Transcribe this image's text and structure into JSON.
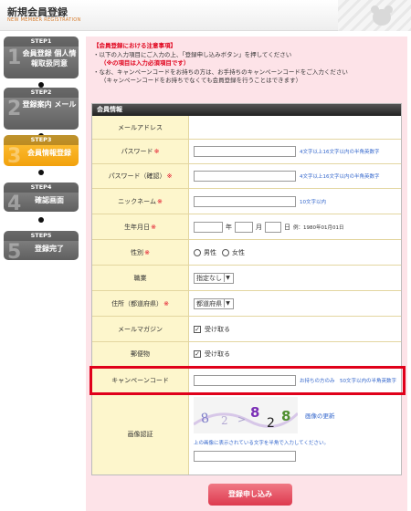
{
  "header": {
    "title": "新規会員登録",
    "subtitle": "NEW MEMBER REGISTRATION"
  },
  "steps": [
    {
      "label": "STEP1",
      "text": "会員登録 個人情報取扱同意",
      "num": "1",
      "active": false
    },
    {
      "label": "STEP2",
      "text": "登録案内 メール",
      "num": "2",
      "active": false
    },
    {
      "label": "STEP3",
      "text": "会員情報登録",
      "num": "3",
      "active": true
    },
    {
      "label": "STEP4",
      "text": "確認画面",
      "num": "4",
      "active": false
    },
    {
      "label": "STEP5",
      "text": "登録完了",
      "num": "5",
      "active": false
    }
  ],
  "notice": {
    "title": "【会員登録における注意事項】",
    "line1": "・以下の入力項目にご入力の上、「登録申し込みボタン」を押してください",
    "line2": "（※の項目は入力必須項目です）",
    "line3": "・なお、キャンペーンコードをお持ちの方は、お手持ちのキャンペーンコードをご入力ください",
    "line4": "（キャンペーンコードをお持ちでなくても会員登録を行うことはできます）"
  },
  "form": {
    "section_title": "会員情報",
    "email_label": "メールアドレス",
    "password_label": "パスワード",
    "password_hint": "4文字以上16文字以内の半角英数字",
    "password_confirm_label": "パスワード（確認）",
    "password_confirm_hint": "4文字以上16文字以内の半角英数字",
    "nickname_label": "ニックネーム",
    "nickname_hint": "10文字以内",
    "birth_label": "生年月日",
    "birth_year_unit": "年",
    "birth_month_unit": "月",
    "birth_day_unit": "日",
    "birth_example": "例：1980年01月01日",
    "gender_label": "性別",
    "gender_male": "男性",
    "gender_female": "女性",
    "job_label": "職業",
    "job_value": "指定なし",
    "address_label": "住所（都道府県）",
    "address_value": "都道府県",
    "magazine_label": "メールマガジン",
    "magazine_value": "受け取る",
    "mail_label": "郵便物",
    "mail_value": "受け取る",
    "campaign_label": "キャンペーンコード",
    "campaign_hint": "お持ちの方のみ　50文字以内の半角英数字",
    "captcha_label": "画像認証",
    "captcha_text": "8 2 > 8 2 8",
    "captcha_refresh": "画像の更新",
    "captcha_hint": "上の画像に表示されている文字を半角で入力してください。",
    "required_mark": "※"
  },
  "submit_label": "登録申し込み"
}
